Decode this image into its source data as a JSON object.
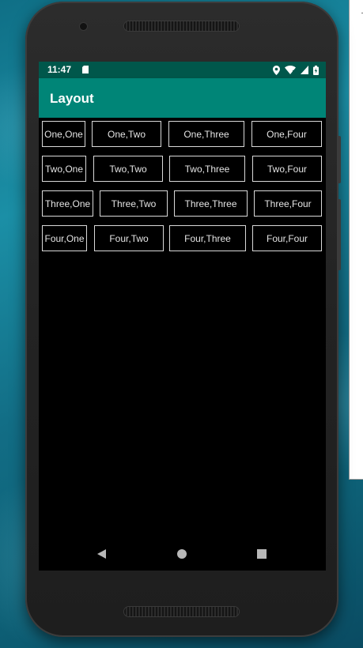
{
  "status_bar": {
    "time": "11:47"
  },
  "app_bar": {
    "title": "Layout",
    "color": "#008577",
    "status_color": "#00574b"
  },
  "grid": {
    "rows": [
      [
        "One,One",
        "One,Two",
        "One,Three",
        "One,Four"
      ],
      [
        "Two,One",
        "Two,Two",
        "Two,Three",
        "Two,Four"
      ],
      [
        "Three,One",
        "Three,Two",
        "Three,Three",
        "Three,Four"
      ],
      [
        "Four,One",
        "Four,Two",
        "Four,Three",
        "Four,Four"
      ]
    ]
  },
  "icons": {
    "status": [
      "sd-card-icon",
      "location-icon",
      "wifi-icon",
      "cell-signal-icon",
      "battery-icon"
    ],
    "nav": [
      "back-icon",
      "home-icon",
      "recents-icon"
    ]
  }
}
